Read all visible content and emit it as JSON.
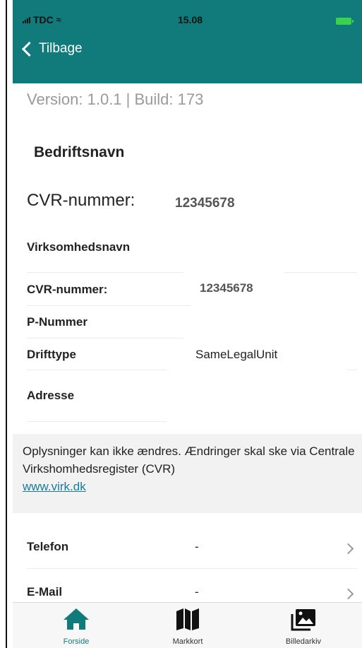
{
  "status": {
    "carrier": "TDC",
    "time": "15.08"
  },
  "nav": {
    "back_label": "Tilbage"
  },
  "version_text": "Version: 1.0.1 | Build: 173",
  "company_name": "Bedriftsnavn",
  "cvr_summary": {
    "label": "CVR-nummer:",
    "value": "12345678"
  },
  "details": [
    {
      "label": "Virksomhedsnavn",
      "value": ""
    },
    {
      "label": "CVR-nummer:",
      "value": "12345678"
    },
    {
      "label": "P-Nummer",
      "value": ""
    },
    {
      "label": "Drifttype",
      "value": "SameLegalUnit"
    },
    {
      "label": "Adresse",
      "value": ""
    }
  ],
  "info": {
    "text": "Oplysninger kan ikke ændres. Ændringer skal ske via Centrale Virkshomhedsregister (CVR)",
    "link": "www.virk.dk"
  },
  "contact_rows": [
    {
      "label": "Telefon",
      "value": "-"
    },
    {
      "label": "E-Mail",
      "value": "-"
    }
  ],
  "tabs": [
    {
      "label": "Forside",
      "icon": "home-icon",
      "active": true
    },
    {
      "label": "Markkort",
      "icon": "map-icon",
      "active": false
    },
    {
      "label": "Billedarkiv",
      "icon": "photos-icon",
      "active": false
    }
  ],
  "colors": {
    "header": "#117a7a",
    "accent": "#117a7a",
    "link": "#1a7a9e"
  }
}
